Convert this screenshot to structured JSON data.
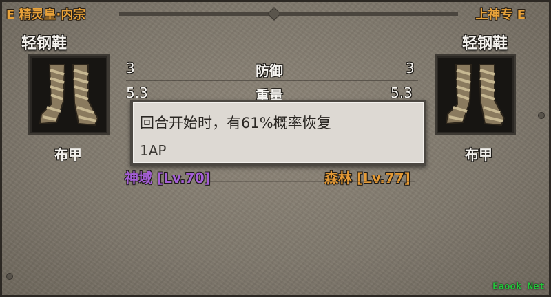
{
  "header": {
    "left_title": "E 精灵皇·内宗",
    "right_title": "上神专 E"
  },
  "left_item": {
    "name": "轻钢鞋",
    "icon": "cloth-boots-icon",
    "type": "布甲",
    "condition": "神域 [Lv.70]",
    "condition_color": "#a55fd7"
  },
  "right_item": {
    "name": "轻钢鞋",
    "icon": "cloth-boots-icon",
    "type": "布甲",
    "condition": "森林 [Lv.77]",
    "condition_color": "#e59a35"
  },
  "stats": [
    {
      "label": "防御",
      "left": "3",
      "right": "3"
    },
    {
      "label": "重量",
      "left": "5.3",
      "right": "5.3"
    }
  ],
  "tooltip": {
    "line1": "回合开始时，有61%概率恢复",
    "line2": "1AP"
  },
  "watermark": "Eaook Net"
}
